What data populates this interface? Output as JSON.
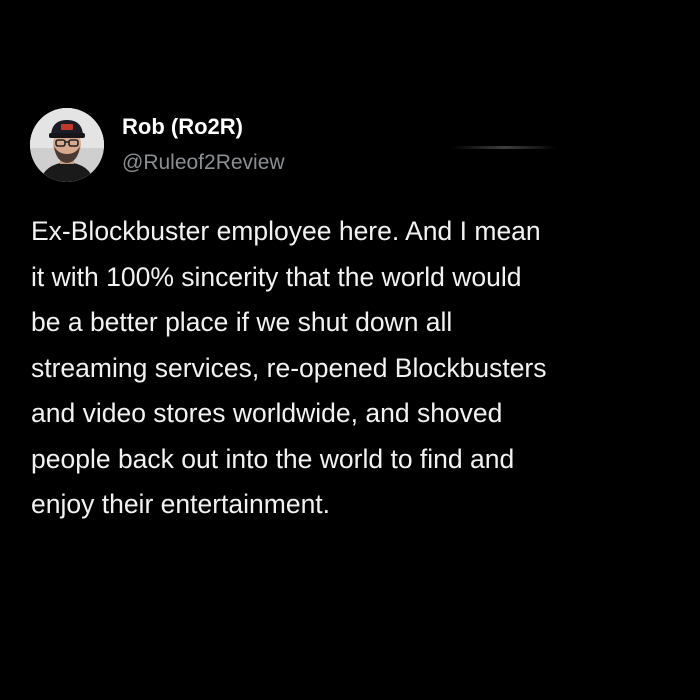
{
  "post": {
    "author": {
      "display_name": "Rob (Ro2R)",
      "handle": "@Ruleof2Review",
      "avatar_icon": "profile-avatar"
    },
    "text_lines": [
      "Ex-Blockbuster employee here. And I mean",
      "it with 100% sincerity that the world would",
      "be a better place if we shut down all",
      "streaming services, re-opened Blockbusters",
      "and video stores worldwide, and shoved",
      "people back out into the world to find and",
      "enjoy their entertainment."
    ]
  },
  "colors": {
    "background": "#000000",
    "name": "#ffffff",
    "handle": "#8b8f93",
    "body": "#f2f2f2"
  }
}
